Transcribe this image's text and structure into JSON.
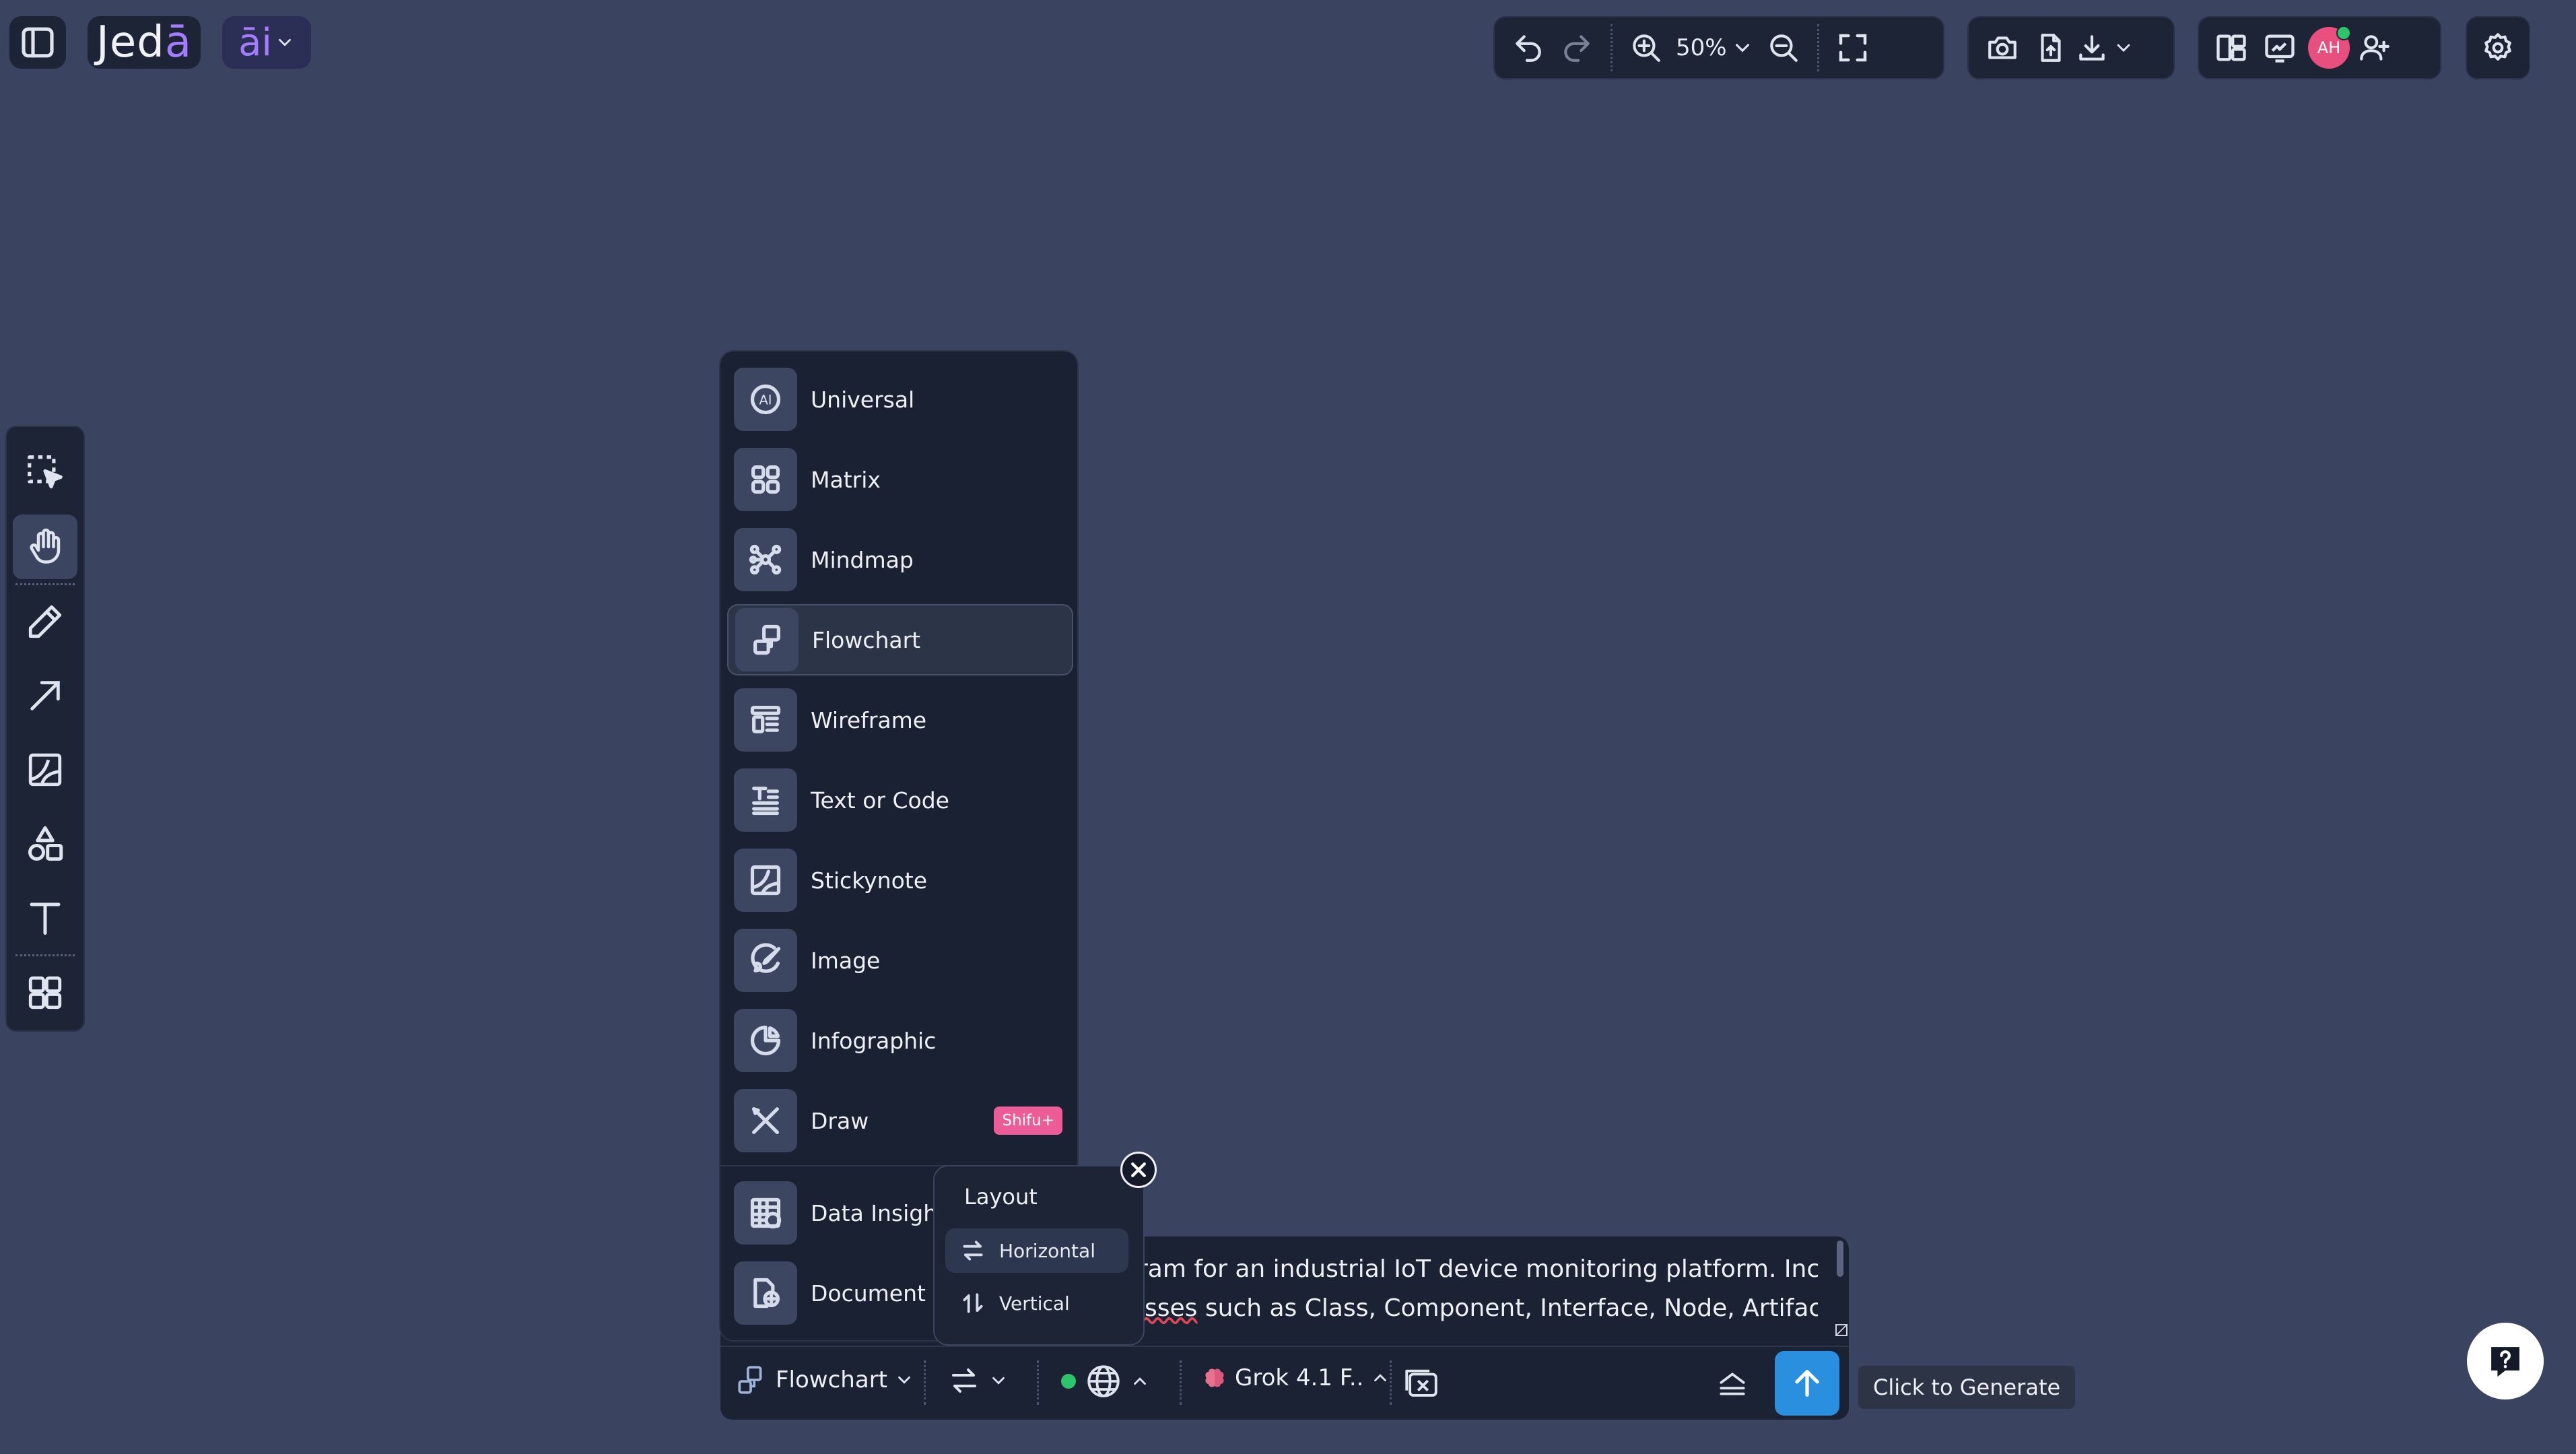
{
  "header": {
    "logo_text": "Jedā",
    "logo_main": "Jed",
    "logo_accent": "ā",
    "ai_label": "āi"
  },
  "toolbar": {
    "zoom_value": "50%"
  },
  "avatar": {
    "initials": "AH",
    "color": "#e94f7e",
    "online_color": "#2ec46b"
  },
  "menu": {
    "items": [
      {
        "label": "Universal",
        "icon": "ai-circle-icon"
      },
      {
        "label": "Matrix",
        "icon": "grid-icon"
      },
      {
        "label": "Mindmap",
        "icon": "mindmap-icon"
      },
      {
        "label": "Flowchart",
        "icon": "flowchart-icon",
        "active": true
      },
      {
        "label": "Wireframe",
        "icon": "wireframe-icon"
      },
      {
        "label": "Text or Code",
        "icon": "text-code-icon"
      },
      {
        "label": "Stickynote",
        "icon": "stickynote-icon"
      },
      {
        "label": "Image",
        "icon": "image-brush-icon"
      },
      {
        "label": "Infographic",
        "icon": "infographic-icon"
      },
      {
        "label": "Draw",
        "icon": "draw-icon",
        "badge": "Shifu+"
      },
      {
        "label": "Data Insight",
        "icon": "data-table-icon"
      },
      {
        "label": "Document Ir",
        "icon": "document-icon"
      }
    ]
  },
  "layout_popup": {
    "title": "Layout",
    "options": [
      {
        "label": "Horizontal",
        "selected": true
      },
      {
        "label": "Vertical",
        "selected": false
      }
    ]
  },
  "prompt": {
    "line1": "ram for an industrial IoT device monitoring platform. Include",
    "line2_pre": "",
    "line2_underlined": "isses",
    "line2_post": " such as Class, Component, Interface, Node, Artifact,"
  },
  "bottom_bar": {
    "mode_label": "Flowchart",
    "model_label": "Grok 4.1 F..",
    "status_color": "#2ec46b",
    "generate_color": "#2b8fe0"
  },
  "tooltip": {
    "text": "Click to Generate"
  }
}
